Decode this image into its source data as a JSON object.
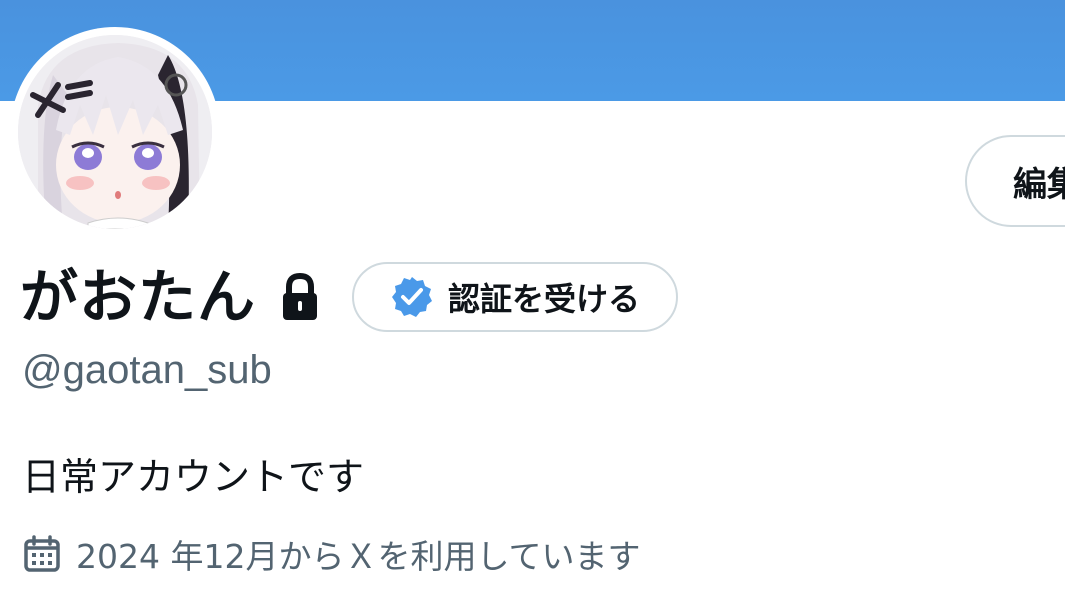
{
  "profile": {
    "display_name": "がおたん",
    "handle": "@gaotan_sub",
    "bio": "日常アカウントです",
    "joined": "2024 年12月からＸを利用しています"
  },
  "actions": {
    "edit_label": "編集",
    "verify_label": "認証を受ける"
  },
  "icons": {
    "lock": "lock-icon",
    "verified": "verified-badge-icon",
    "calendar": "calendar-icon"
  },
  "colors": {
    "banner": "#4a92de",
    "verified_blue": "#4a99e9",
    "secondary_text": "#536471",
    "border": "#cfd9de"
  }
}
